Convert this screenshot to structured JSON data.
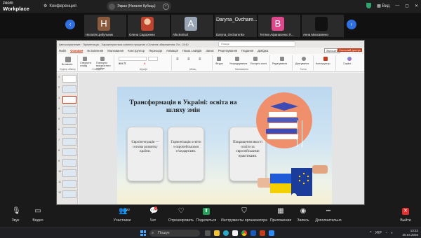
{
  "zoom": {
    "logo_line1": "zoom",
    "logo_line2": "Workplace",
    "meeting_label": "Конференция",
    "screen_share_label": "Экран (Наталія Кубєць)",
    "view_label": "Вид",
    "participants_strip": [
      {
        "initial": "H",
        "name": "Наталія Цибульник",
        "color": "#8a5a3c"
      },
      {
        "initial": "",
        "name": "Олена Сидоренко",
        "color": "#c0442d"
      },
      {
        "initial": "A",
        "name": "Alla Borisol",
        "color": "#9aa6b6"
      },
      {
        "initial": "",
        "name": "Daryna_Ovcharenko",
        "color": "#2d2d2d",
        "overlay": "Daryna_Ovchare..."
      },
      {
        "initial": "B",
        "name": "Тетяна Афанасенко П...",
        "color": "#e0488c"
      },
      {
        "initial": "",
        "name": "Анна Михсавенко",
        "color": "#111111"
      }
    ],
    "controls": [
      {
        "icon": "microphone-icon",
        "glyph": "🎙",
        "label": "Звук"
      },
      {
        "icon": "video-camera-icon",
        "glyph": "▭",
        "label": "Видео"
      },
      {
        "icon": "participants-icon",
        "glyph": "👥",
        "label": "Участники",
        "count": "22"
      },
      {
        "icon": "chat-icon",
        "glyph": "💬",
        "label": "Чат",
        "badge": "4"
      },
      {
        "icon": "react-icon",
        "glyph": "♡",
        "label": "Отреагировать"
      },
      {
        "icon": "share-screen-icon",
        "glyph": "⬆",
        "label": "Поделиться"
      },
      {
        "icon": "host-tools-icon",
        "glyph": "⛉",
        "label": "Инструменты организатора"
      },
      {
        "icon": "apps-icon",
        "glyph": "▦",
        "label": "Приложения"
      },
      {
        "icon": "record-icon",
        "glyph": "◉",
        "label": "Запись"
      },
      {
        "icon": "more-icon",
        "glyph": "•••",
        "label": "Дополнительно"
      },
      {
        "icon": "leave-icon",
        "glyph": "✕",
        "label": "Выйти"
      }
    ]
  },
  "powerpoint": {
    "title_bar": "Автосохранение  ·  Презентація - Характеристика освітніх процесів • Останнє збереження: Пн, 13:40",
    "search_placeholder": "Пошук",
    "tabs": [
      "Файл",
      "Основне",
      "Вставлення",
      "Малювання",
      "Конструктор",
      "Переходи",
      "Анімація",
      "Показ слайдів",
      "Запис",
      "Рецензування",
      "Подання",
      "Довідка"
    ],
    "active_tab": "Основне",
    "record_button": "Записати",
    "share_button": "Спільний доступ",
    "ribbon_groups": [
      {
        "label": "Буфер обміну",
        "items": [
          "Вставити"
        ]
      },
      {
        "label": "Слайди",
        "items": [
          "Створити слайд",
          "Повторно використати слайди"
        ]
      },
      {
        "label": "Шрифт",
        "items": [
          "A",
          "Ж К П"
        ]
      },
      {
        "label": "Абзац",
        "items": [
          "≡"
        ]
      },
      {
        "label": "Малювання",
        "items": [
          "Фігури",
          "Упорядкування",
          "Експрес-стилі"
        ]
      },
      {
        "label": "Редагування",
        "items": [
          "Редагування"
        ]
      },
      {
        "label": "Голос",
        "items": [
          "Диктування"
        ]
      },
      {
        "label": "Конструктор",
        "items": [
          "Конструктор"
        ]
      },
      {
        "label": "Copilot",
        "items": [
          "Copilot"
        ]
      }
    ],
    "slide_numbers": [
      "1",
      "2",
      "3",
      "4",
      "5",
      "6",
      "7",
      "8",
      "9",
      "10",
      "11",
      "12"
    ],
    "selected_slide": "3",
    "slide": {
      "title": "Трансформація в Україні: освіта на шляху змін",
      "cards": [
        "Євроінтеграція — основа розвитку країни.",
        "Гармонізація освіти з європейськими стандартами.",
        "Покращення якості освіти за європейськими практиками."
      ]
    }
  },
  "taskbar": {
    "search_placeholder": "Пошук",
    "language": "УКР",
    "time": "13:22",
    "date": "30.04.2025"
  }
}
